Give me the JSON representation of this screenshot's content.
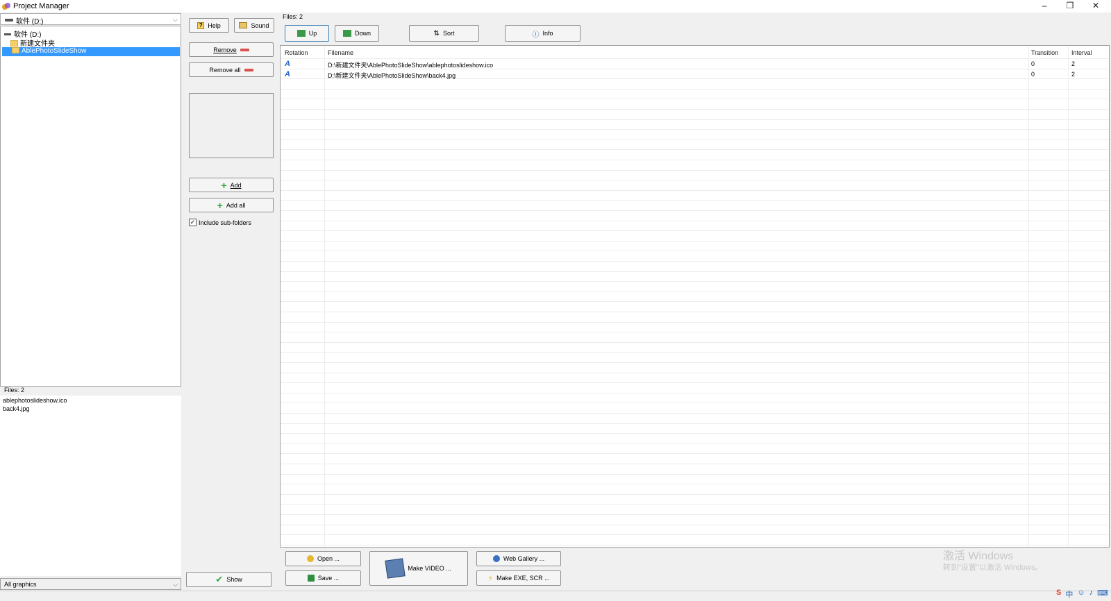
{
  "window": {
    "title": "Project Manager",
    "min": "–",
    "max": "❐",
    "close": "✕"
  },
  "left": {
    "drive": "软件 (D:)",
    "tree": [
      {
        "label": "软件 (D:)"
      },
      {
        "label": "新建文件夹"
      },
      {
        "label": "AblePhotoSlideShow"
      }
    ],
    "files_label": "Files: 2",
    "files": [
      "ablephotoslideshow.ico",
      "back4.jpg"
    ],
    "filter": "All graphics"
  },
  "middle": {
    "help": "Help",
    "sound": "Sound",
    "remove": "Remove",
    "remove_all": "Remove all",
    "add": "Add",
    "add_all": "Add all",
    "include_sub": "Include sub-folders",
    "show": "Show"
  },
  "right": {
    "files_count": "Files: 2",
    "toolbar": {
      "up": "Up",
      "down": "Down",
      "sort": "Sort",
      "info": "Info"
    },
    "columns": {
      "rotation": "Rotation",
      "filename": "Filename",
      "transition": "Transition",
      "interval": "Interval"
    },
    "rows": [
      {
        "rotation": "A",
        "filename": "D:\\新建文件夹\\AblePhotoSlideShow\\ablephotoslideshow.ico",
        "transition": "0",
        "interval": "2"
      },
      {
        "rotation": "A",
        "filename": "D:\\新建文件夹\\AblePhotoSlideShow\\back4.jpg",
        "transition": "0",
        "interval": "2"
      }
    ]
  },
  "bottom": {
    "open": "Open ...",
    "save": "Save ...",
    "make_video": "Make VIDEO ...",
    "web_gallery": "Web Gallery ...",
    "make_exe": "Make EXE, SCR ..."
  },
  "watermark": {
    "line1": "激活 Windows",
    "line2": "转到\"设置\"以激活 Windows。"
  },
  "tray": {
    "ime": "中"
  }
}
